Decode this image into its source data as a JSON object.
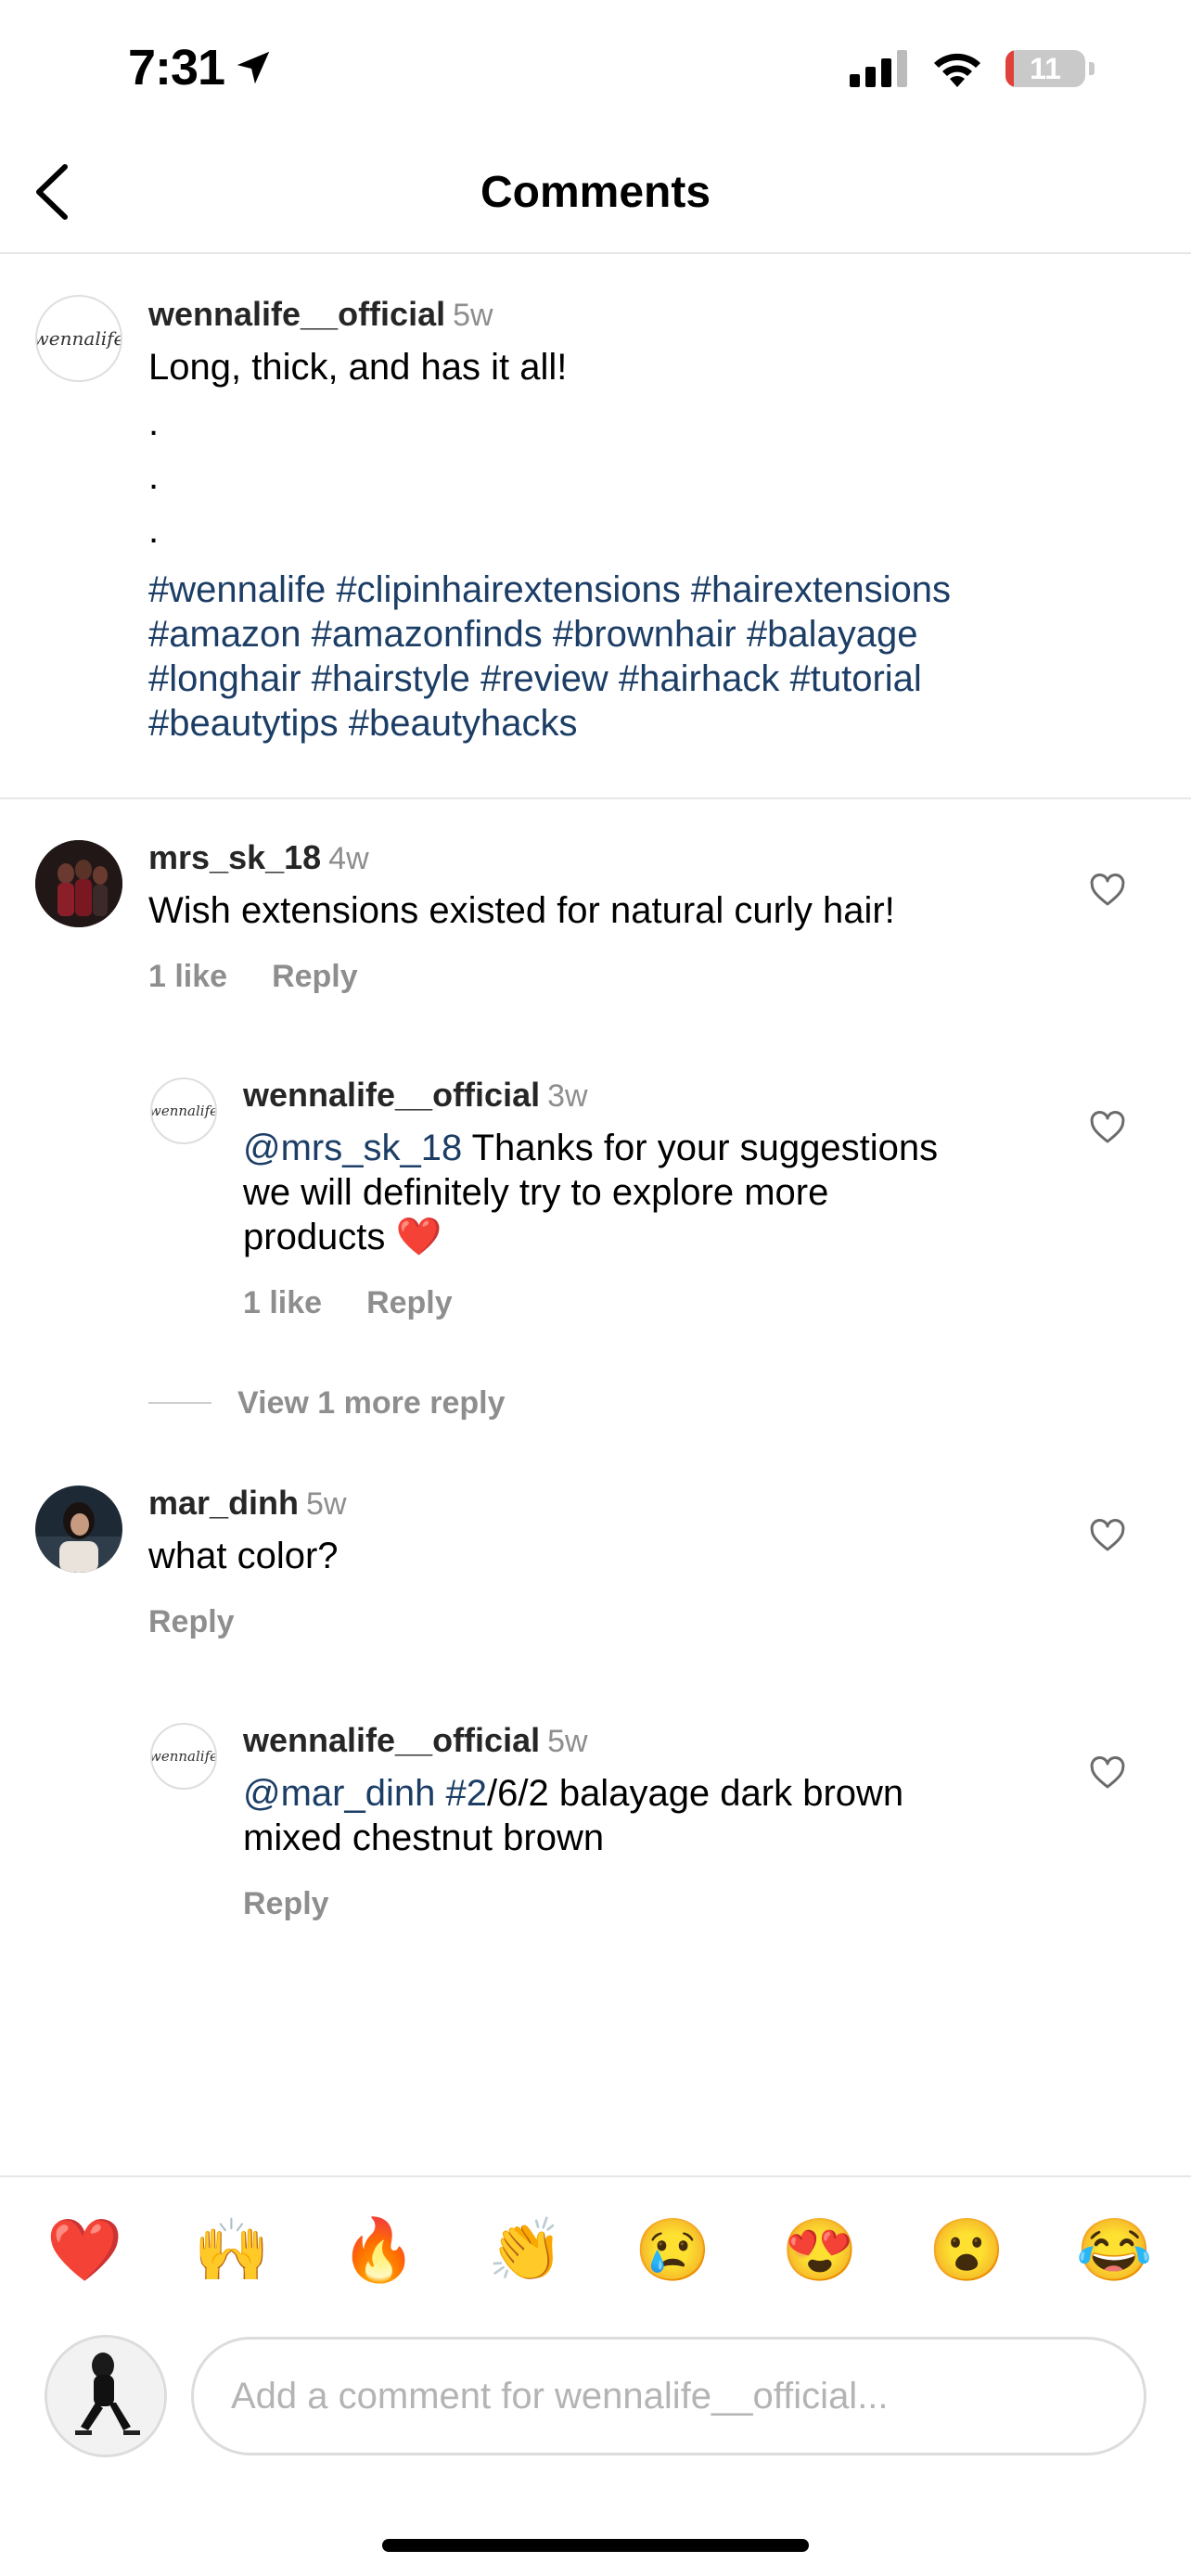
{
  "status_bar": {
    "time": "7:31",
    "battery": "11",
    "battery_level": 0.11
  },
  "header": {
    "title": "Comments"
  },
  "caption": {
    "username": "wennalife__official",
    "age": "5w",
    "text": "Long, thick, and has it all!",
    "dots": [
      ".",
      ".",
      "."
    ],
    "hashtag_lines": [
      "#wennalife #clipinhairextensions #hairextensions",
      "#amazon #amazonfinds #brownhair #balayage",
      "#longhair #hairstyle #review #hairhack #tutorial",
      "#beautytips #beautyhacks"
    ],
    "avatar_text": "wennalife"
  },
  "comments": [
    {
      "username": "mrs_sk_18",
      "age": "4w",
      "text": "Wish extensions existed for natural curly hair!",
      "likes": "1 like",
      "reply": "Reply",
      "replies": [
        {
          "username": "wennalife__official",
          "age": "3w",
          "mention": "@mrs_sk_18",
          "text_lines": [
            " Thanks for your suggestions",
            "we will definitely try to explore more",
            "products ❤️"
          ],
          "likes": "1 like",
          "reply": "Reply"
        }
      ],
      "view_more": "View 1 more reply"
    },
    {
      "username": "mar_dinh",
      "age": "5w",
      "text": "what color?",
      "reply": "Reply",
      "replies": [
        {
          "username": "wennalife__official",
          "age": "5w",
          "mention": "@mar_dinh",
          "hashtag": " #2",
          "text_lines": [
            "/6/2 balayage dark brown",
            "mixed chestnut brown"
          ],
          "reply": "Reply"
        }
      ]
    }
  ],
  "emoji_bar": [
    "❤️",
    "🙌",
    "🔥",
    "👏",
    "😢",
    "😍",
    "😮",
    "😂"
  ],
  "composer": {
    "placeholder": "Add a comment for wennalife__official..."
  },
  "colors": {
    "hashtag": "#1c3e66",
    "muted": "#8e8e8e",
    "divider": "#e6e6e6"
  }
}
